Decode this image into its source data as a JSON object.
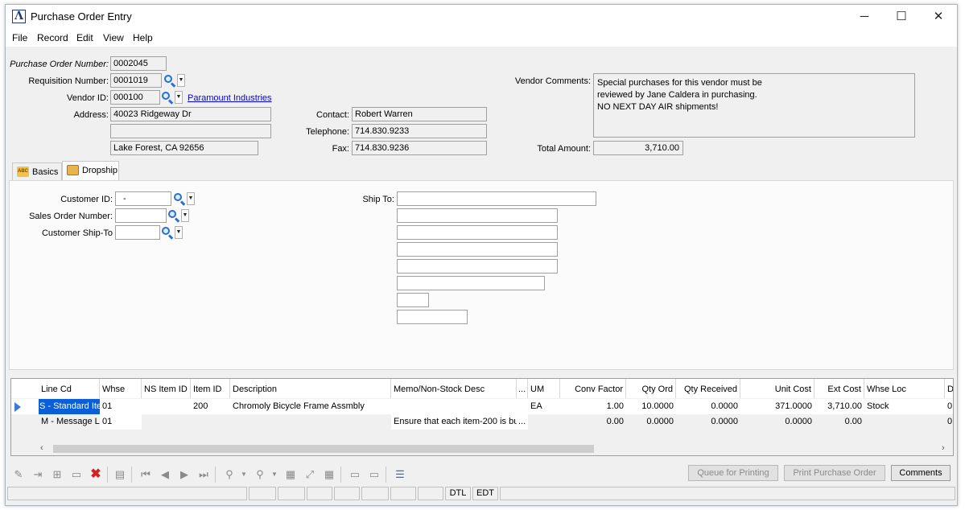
{
  "window": {
    "title": "Purchase Order Entry",
    "icon_glyph": "Λ",
    "minimize_glyph": "─",
    "maximize_glyph": "☐",
    "close_glyph": "✕"
  },
  "menu": [
    "File",
    "Record",
    "Edit",
    "View",
    "Help"
  ],
  "header": {
    "po_number_label": "Purchase Order Number:",
    "po_number": "0002045",
    "requisition_label": "Requisition Number:",
    "requisition": "0001019",
    "vendor_label": "Vendor ID:",
    "vendor_id": "000100",
    "vendor_name": "Paramount Industries",
    "address_label": "Address:",
    "address1": "40023 Ridgeway Dr",
    "address2": "",
    "city_state_zip": "Lake Forest, CA  92656",
    "contact_label": "Contact:",
    "contact": "Robert Warren",
    "telephone_label": "Telephone:",
    "telephone": "714.830.9233",
    "fax_label": "Fax:",
    "fax": "714.830.9236",
    "vendor_comments_label": "Vendor Comments:",
    "vendor_comments": [
      "Special purchases for this vendor must be",
      "reviewed by Jane Caldera in purchasing.",
      "NO NEXT DAY AIR shipments!"
    ],
    "total_label": "Total Amount:",
    "total_amount": "3,710.00"
  },
  "tabs": [
    {
      "label": "Basics",
      "icon": "abc-icon"
    },
    {
      "label": "Dropship",
      "icon": "dropship-icon"
    }
  ],
  "dropship": {
    "customer_id_label": "Customer ID:",
    "customer_id": "-",
    "sales_order_label": "Sales Order Number:",
    "sales_order": "",
    "ship_to_id_label": "Customer Ship-To",
    "ship_to_id": "",
    "ship_to_label": "Ship To:"
  },
  "grid": {
    "columns": [
      "Line Cd",
      "Whse",
      "NS Item ID",
      "Item ID",
      "Description",
      "Memo/Non-Stock Desc",
      "...",
      "UM",
      "Conv Factor",
      "Qty Ord",
      "Qty Received",
      "Unit Cost",
      "Ext Cost",
      "Whse Loc",
      "D"
    ],
    "rows": [
      {
        "line_cd": "S - Standard Ite",
        "whse": "01",
        "ns_item": "",
        "item": "200",
        "desc": "Chromoly Bicycle Frame Assmbly",
        "memo": "",
        "more": "",
        "um": "EA",
        "conv": "1.00",
        "qty_ord": "10.0000",
        "qty_rec": "0.0000",
        "unit_cost": "371.0000",
        "ext_cost": "3,710.00",
        "whse_loc": "Stock",
        "d": "0"
      },
      {
        "line_cd": "M - Message Lin",
        "whse": "01",
        "ns_item": "",
        "item": "",
        "desc": "",
        "memo": "Ensure that each item-200 is bu",
        "more": "...",
        "um": "",
        "conv": "0.00",
        "qty_ord": "0.0000",
        "qty_rec": "0.0000",
        "unit_cost": "0.0000",
        "ext_cost": "0.00",
        "whse_loc": "",
        "d": "0"
      }
    ]
  },
  "buttons": {
    "queue": "Queue for Printing",
    "print": "Print Purchase Order",
    "comments": "Comments"
  },
  "status": {
    "dtl": "DTL",
    "edt": "EDT"
  }
}
